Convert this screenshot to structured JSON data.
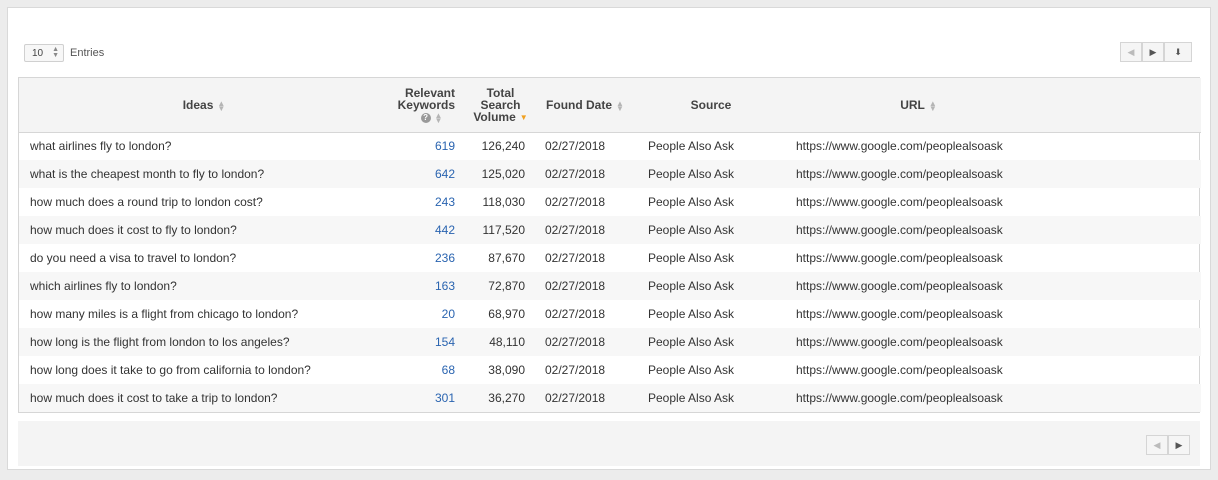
{
  "entries": {
    "value": "10",
    "label": "Entries"
  },
  "pager": {
    "prev_icon": "◀",
    "next_icon": "▶",
    "download_icon": "⬇"
  },
  "table": {
    "headers": {
      "ideas": "Ideas",
      "keywords_line1": "Relevant",
      "keywords_line2": "Keywords",
      "volume_line1": "Total",
      "volume_line2": "Search",
      "volume_line3": "Volume",
      "date": "Found Date",
      "source": "Source",
      "url": "URL"
    },
    "rows": [
      {
        "idea": "what airlines fly to london?",
        "keywords": "619",
        "volume": "126,240",
        "date": "02/27/2018",
        "source": "People Also Ask",
        "url": "https://www.google.com/peoplealsoask"
      },
      {
        "idea": "what is the cheapest month to fly to london?",
        "keywords": "642",
        "volume": "125,020",
        "date": "02/27/2018",
        "source": "People Also Ask",
        "url": "https://www.google.com/peoplealsoask"
      },
      {
        "idea": "how much does a round trip to london cost?",
        "keywords": "243",
        "volume": "118,030",
        "date": "02/27/2018",
        "source": "People Also Ask",
        "url": "https://www.google.com/peoplealsoask"
      },
      {
        "idea": "how much does it cost to fly to london?",
        "keywords": "442",
        "volume": "117,520",
        "date": "02/27/2018",
        "source": "People Also Ask",
        "url": "https://www.google.com/peoplealsoask"
      },
      {
        "idea": "do you need a visa to travel to london?",
        "keywords": "236",
        "volume": "87,670",
        "date": "02/27/2018",
        "source": "People Also Ask",
        "url": "https://www.google.com/peoplealsoask"
      },
      {
        "idea": "which airlines fly to london?",
        "keywords": "163",
        "volume": "72,870",
        "date": "02/27/2018",
        "source": "People Also Ask",
        "url": "https://www.google.com/peoplealsoask"
      },
      {
        "idea": "how many miles is a flight from chicago to london?",
        "keywords": "20",
        "volume": "68,970",
        "date": "02/27/2018",
        "source": "People Also Ask",
        "url": "https://www.google.com/peoplealsoask"
      },
      {
        "idea": "how long is the flight from london to los angeles?",
        "keywords": "154",
        "volume": "48,110",
        "date": "02/27/2018",
        "source": "People Also Ask",
        "url": "https://www.google.com/peoplealsoask"
      },
      {
        "idea": "how long does it take to go from california to london?",
        "keywords": "68",
        "volume": "38,090",
        "date": "02/27/2018",
        "source": "People Also Ask",
        "url": "https://www.google.com/peoplealsoask"
      },
      {
        "idea": "how much does it cost to take a trip to london?",
        "keywords": "301",
        "volume": "36,270",
        "date": "02/27/2018",
        "source": "People Also Ask",
        "url": "https://www.google.com/peoplealsoask"
      }
    ]
  }
}
